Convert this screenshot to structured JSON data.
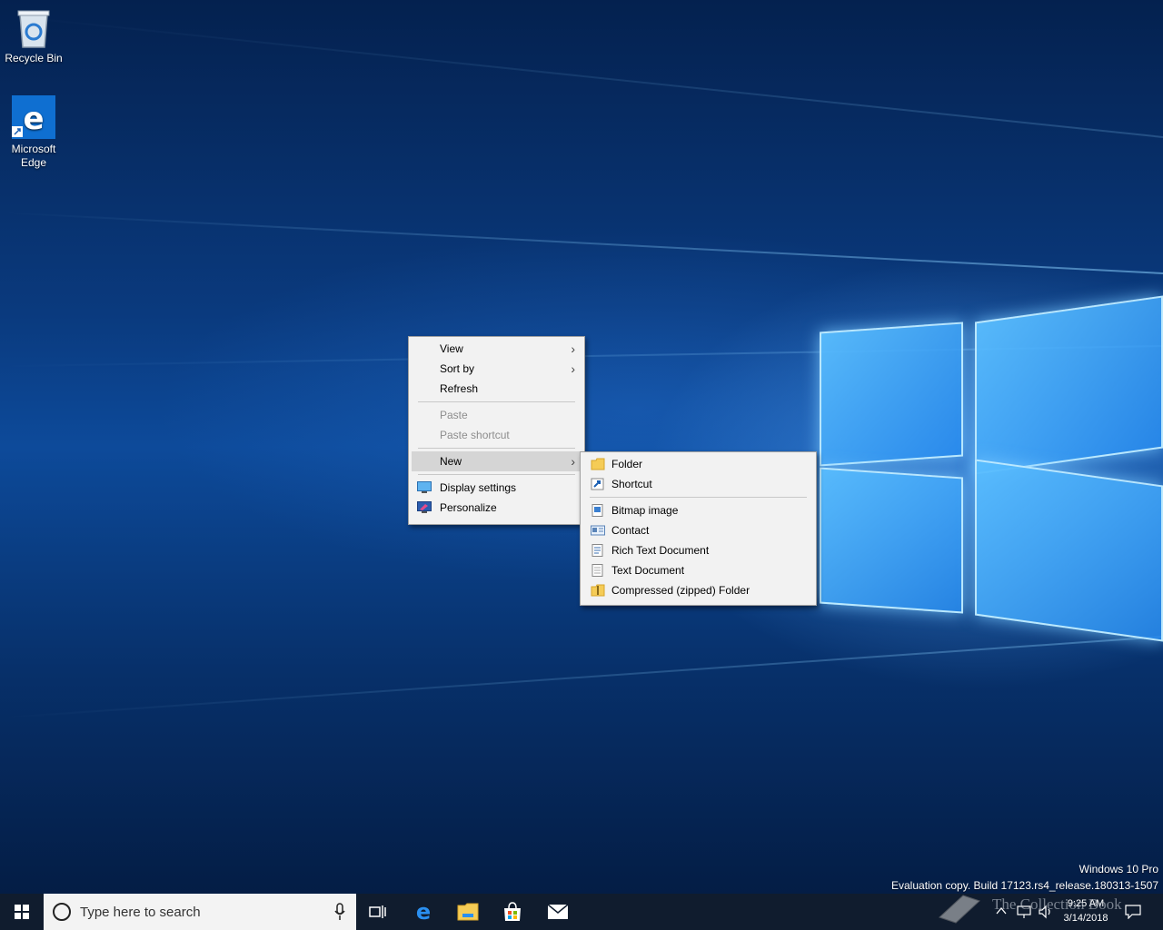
{
  "desktop": {
    "icons": [
      {
        "label": "Recycle Bin",
        "icon": "recycle-bin-icon"
      },
      {
        "label": "Microsoft Edge",
        "icon": "edge-icon"
      }
    ]
  },
  "context_menu": {
    "items": [
      {
        "label": "View",
        "has_submenu": true
      },
      {
        "label": "Sort by",
        "has_submenu": true
      },
      {
        "label": "Refresh"
      },
      {
        "label": "Paste",
        "disabled": true
      },
      {
        "label": "Paste shortcut",
        "disabled": true
      },
      {
        "label": "New",
        "has_submenu": true,
        "highlighted": true
      },
      {
        "label": "Display settings",
        "icon": "display-settings-icon"
      },
      {
        "label": "Personalize",
        "icon": "personalize-icon"
      }
    ]
  },
  "new_submenu": {
    "items": [
      {
        "label": "Folder",
        "icon": "folder-icon"
      },
      {
        "label": "Shortcut",
        "icon": "shortcut-icon"
      },
      {
        "label": "Bitmap image",
        "icon": "bitmap-image-icon"
      },
      {
        "label": "Contact",
        "icon": "contact-icon"
      },
      {
        "label": "Rich Text Document",
        "icon": "rich-text-document-icon"
      },
      {
        "label": "Text Document",
        "icon": "text-document-icon"
      },
      {
        "label": "Compressed (zipped) Folder",
        "icon": "zip-folder-icon"
      }
    ]
  },
  "watermark": {
    "line1": "Windows 10 Pro",
    "line2": "Evaluation copy. Build 17123.rs4_release.180313-1507"
  },
  "taskbar": {
    "search_placeholder": "Type here to search",
    "pinned": [
      "task-view-icon",
      "edge-icon",
      "file-explorer-icon",
      "store-icon",
      "mail-icon"
    ],
    "clock_time": "9:25 AM",
    "clock_date": "3/14/2018",
    "overlay_text": "The Collection Book"
  },
  "colors": {
    "taskbar": "#101c2e",
    "menu_bg": "#f2f2f2",
    "menu_highlight": "#d5d5d5",
    "edge_blue": "#0f6fd1"
  }
}
